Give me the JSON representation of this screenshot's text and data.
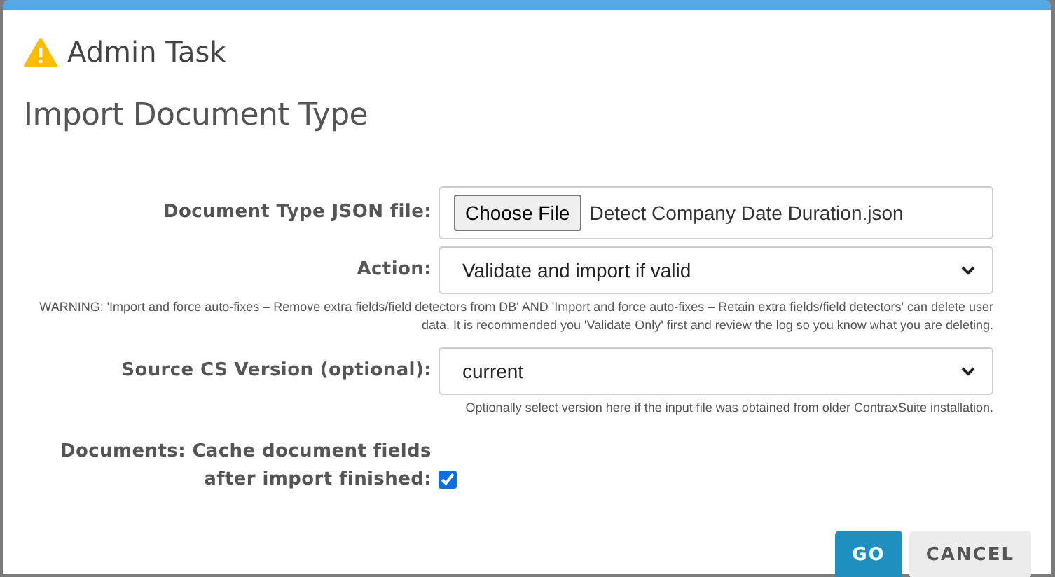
{
  "dialog": {
    "header": "Admin Task",
    "title": "Import Document Type"
  },
  "fields": [
    {
      "kind": "file",
      "label": "Document Type JSON file:",
      "button": "Choose File",
      "value": "Detect Company Date Duration.json"
    },
    {
      "kind": "select",
      "label": "Action:",
      "value": "Validate and import if valid",
      "note": "WARNING: 'Import and force auto-fixes – Remove extra fields/field detectors from DB' AND 'Import and force auto-fixes – Retain extra fields/field detectors' can delete user data. It is recommended you 'Validate Only' first and review the log so you know what you are deleting."
    },
    {
      "kind": "select",
      "label": "Source CS Version (optional):",
      "value": "current",
      "note": "Optionally select version here if the input file was obtained from older ContraxSuite installation."
    },
    {
      "kind": "checkbox",
      "label": "Documents: Cache document fields after import finished:",
      "checked": true
    }
  ],
  "buttons": [
    {
      "label": "GO",
      "kind": "primary"
    },
    {
      "label": "CANCEL",
      "kind": "secondary"
    }
  ]
}
